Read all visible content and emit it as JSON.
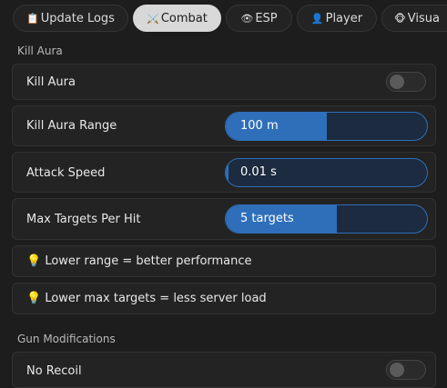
{
  "tabs": [
    {
      "icon": "📋",
      "label": "Update Logs",
      "active": false
    },
    {
      "icon": "⚔️",
      "label": "Combat",
      "active": true
    },
    {
      "icon": "👁",
      "label": "ESP",
      "active": false
    },
    {
      "icon": "👤",
      "label": "Player",
      "active": false
    },
    {
      "icon": "🐵",
      "label": "Visua",
      "active": false
    }
  ],
  "kill_aura": {
    "section_title": "Kill Aura",
    "toggle_label": "Kill Aura",
    "toggle_on": false,
    "range": {
      "label": "Kill Aura Range",
      "value": "100 m",
      "fraction": 0.5
    },
    "attack_speed": {
      "label": "Attack Speed",
      "value": "0.01 s",
      "fraction": 0.01
    },
    "max_targets": {
      "label": "Max Targets Per Hit",
      "value": "5  targets",
      "fraction": 0.55
    },
    "tip1": {
      "icon": "💡",
      "text": "Lower range = better performance"
    },
    "tip2": {
      "icon": "💡",
      "text": "Lower max targets = less server load"
    }
  },
  "gun_mods": {
    "section_title": "Gun Modifications",
    "no_recoil_label": "No Recoil",
    "no_recoil_on": false
  },
  "colors": {
    "accent": "#2f6fba",
    "background": "#1d1d1d",
    "panel": "#232323"
  }
}
